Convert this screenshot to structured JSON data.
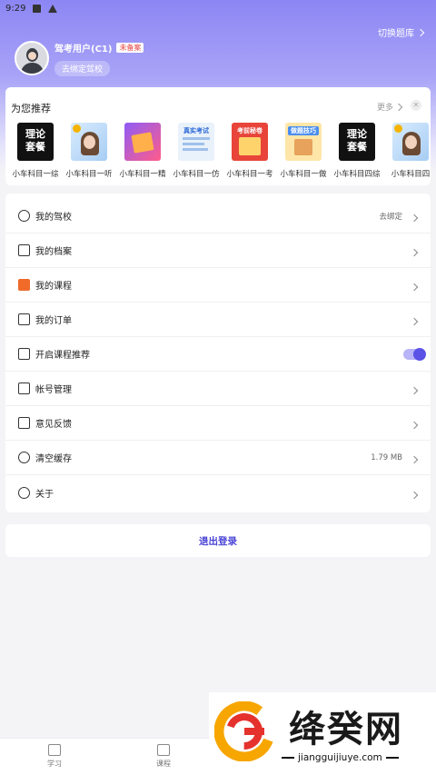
{
  "status_bar": {
    "time": "9:29"
  },
  "header": {
    "switch_bank": "切换题库",
    "username": "驾考用户(C1)",
    "unregistered_badge": "未备案",
    "bind_school": "去绑定驾校"
  },
  "recommend": {
    "title": "为您推荐",
    "more": "更多",
    "items": [
      {
        "label": "小车科目一综",
        "thumb_text": [
          "理论",
          "套餐"
        ],
        "style": "dark"
      },
      {
        "label": "小车科目一听",
        "thumb_text": [],
        "style": "woman"
      },
      {
        "label": "小车科目一精",
        "thumb_text": [],
        "style": "jing"
      },
      {
        "label": "小车科目一仿",
        "thumb_text": [
          "真实考试"
        ],
        "style": "fang"
      },
      {
        "label": "小车科目一考",
        "thumb_text": [
          "考前秘卷"
        ],
        "style": "kao"
      },
      {
        "label": "小车科目一做",
        "thumb_text": [
          "做题技巧"
        ],
        "style": "ji"
      },
      {
        "label": "小车科目四综",
        "thumb_text": [
          "理论",
          "套餐"
        ],
        "style": "dark"
      },
      {
        "label": "小车科目四",
        "thumb_text": [],
        "style": "woman"
      }
    ]
  },
  "menu": [
    {
      "key": "school",
      "label": "我的驾校",
      "value": "去绑定",
      "icon": "steering-icon"
    },
    {
      "key": "profile",
      "label": "我的档案",
      "value": "",
      "icon": "archive-icon"
    },
    {
      "key": "course",
      "label": "我的课程",
      "value": "",
      "icon": "course-icon"
    },
    {
      "key": "orders",
      "label": "我的订单",
      "value": "",
      "icon": "order-icon"
    },
    {
      "key": "course_recommend",
      "label": "开启课程推荐",
      "value": "",
      "icon": "recommend-icon",
      "toggle": true
    },
    {
      "key": "account",
      "label": "帐号管理",
      "value": "",
      "icon": "account-icon"
    },
    {
      "key": "feedback",
      "label": "意见反馈",
      "value": "",
      "icon": "feedback-icon"
    },
    {
      "key": "cache",
      "label": "清空缓存",
      "value": "1.79 MB",
      "icon": "refresh-icon"
    },
    {
      "key": "about",
      "label": "关于",
      "value": "",
      "icon": "info-icon"
    }
  ],
  "logout": "退出登录",
  "tabs": [
    {
      "label": "学习",
      "icon": "book-icon"
    },
    {
      "label": "课程",
      "icon": "course-tab-icon"
    }
  ],
  "watermark": {
    "title": "绛癸网",
    "url": "jiangguijiuye.com"
  },
  "colors": {
    "accent": "#5b52e6",
    "header_top": "#8c86f4",
    "badge_red": "#e54545"
  }
}
